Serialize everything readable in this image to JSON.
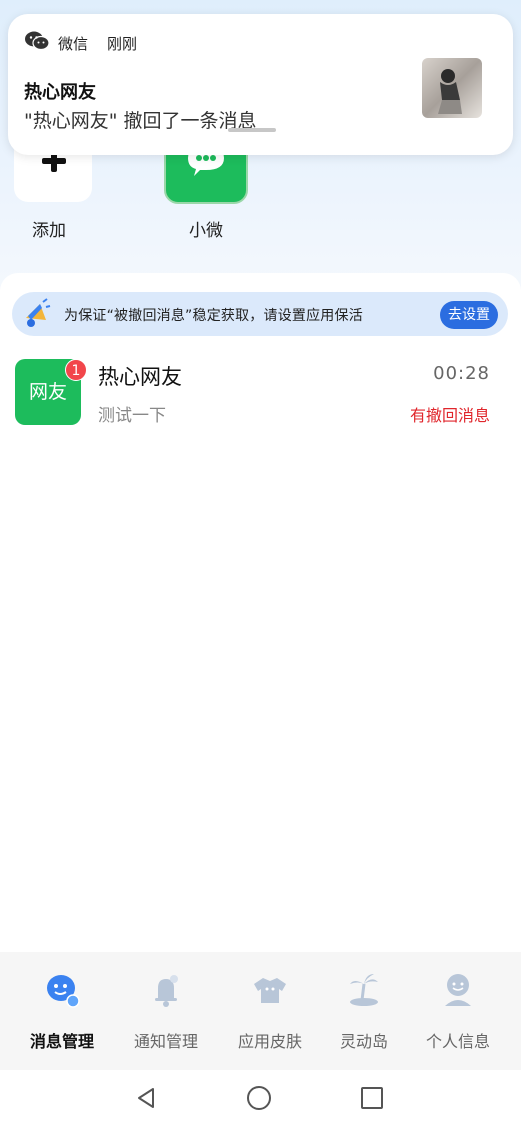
{
  "notification": {
    "app_name": "微信",
    "time": "刚刚",
    "title": "热心网友",
    "body": "\"热心网友\" 撤回了一条消息"
  },
  "shortcuts": {
    "add_label": "添加",
    "app_label": "小微"
  },
  "banner": {
    "text": "为保证“被撤回消息”稳定获取，请设置应用保活",
    "button": "去设置"
  },
  "chat": {
    "avatar_text": "网友",
    "badge_count": "1",
    "name": "热心网友",
    "time": "00:28",
    "message": "测试一下",
    "status": "有撤回消息"
  },
  "bottom_nav": {
    "items": [
      {
        "label": "消息管理",
        "icon": "message-manage-icon",
        "active": true
      },
      {
        "label": "通知管理",
        "icon": "bell-icon",
        "active": false
      },
      {
        "label": "应用皮肤",
        "icon": "tshirt-icon",
        "active": false
      },
      {
        "label": "灵动岛",
        "icon": "island-icon",
        "active": false
      },
      {
        "label": "个人信息",
        "icon": "profile-icon",
        "active": false
      }
    ]
  },
  "colors": {
    "accent_blue": "#2b6de0",
    "wechat_green": "#1dbc5c",
    "alert_red": "#e0262c",
    "badge_red": "#f2464b"
  }
}
